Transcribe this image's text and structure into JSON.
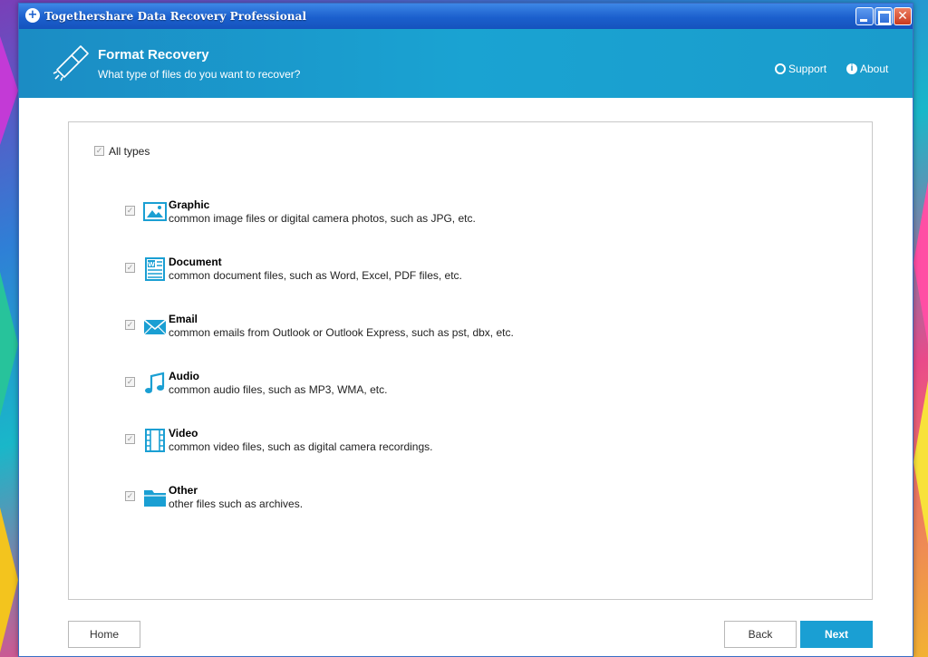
{
  "window": {
    "title": "Togethershare Data Recovery Professional"
  },
  "header": {
    "title": "Format Recovery",
    "subtitle": "What type of files do you want to recover?",
    "support_label": "Support",
    "about_label": "About"
  },
  "panel": {
    "all_types_label": "All types",
    "all_types_checked": true,
    "types": [
      {
        "name": "Graphic",
        "description": "common image files or digital camera photos, such as JPG, etc.",
        "icon": "image-icon",
        "checked": true
      },
      {
        "name": "Document",
        "description": "common document files, such as Word, Excel, PDF files, etc.",
        "icon": "document-icon",
        "checked": true
      },
      {
        "name": "Email",
        "description": "common emails from Outlook or Outlook Express, such as pst, dbx, etc.",
        "icon": "envelope-icon",
        "checked": true
      },
      {
        "name": "Audio",
        "description": "common audio files, such as MP3, WMA, etc.",
        "icon": "music-note-icon",
        "checked": true
      },
      {
        "name": "Video",
        "description": "common video files, such as digital camera recordings.",
        "icon": "film-icon",
        "checked": true
      },
      {
        "name": "Other",
        "description": "other files such as archives.",
        "icon": "folder-icon",
        "checked": true
      }
    ]
  },
  "footer": {
    "home_label": "Home",
    "back_label": "Back",
    "next_label": "Next"
  },
  "colors": {
    "header_bg": "#1aa3d2",
    "accent": "#1a9fd3",
    "titlebar": "#1b5fcd"
  }
}
